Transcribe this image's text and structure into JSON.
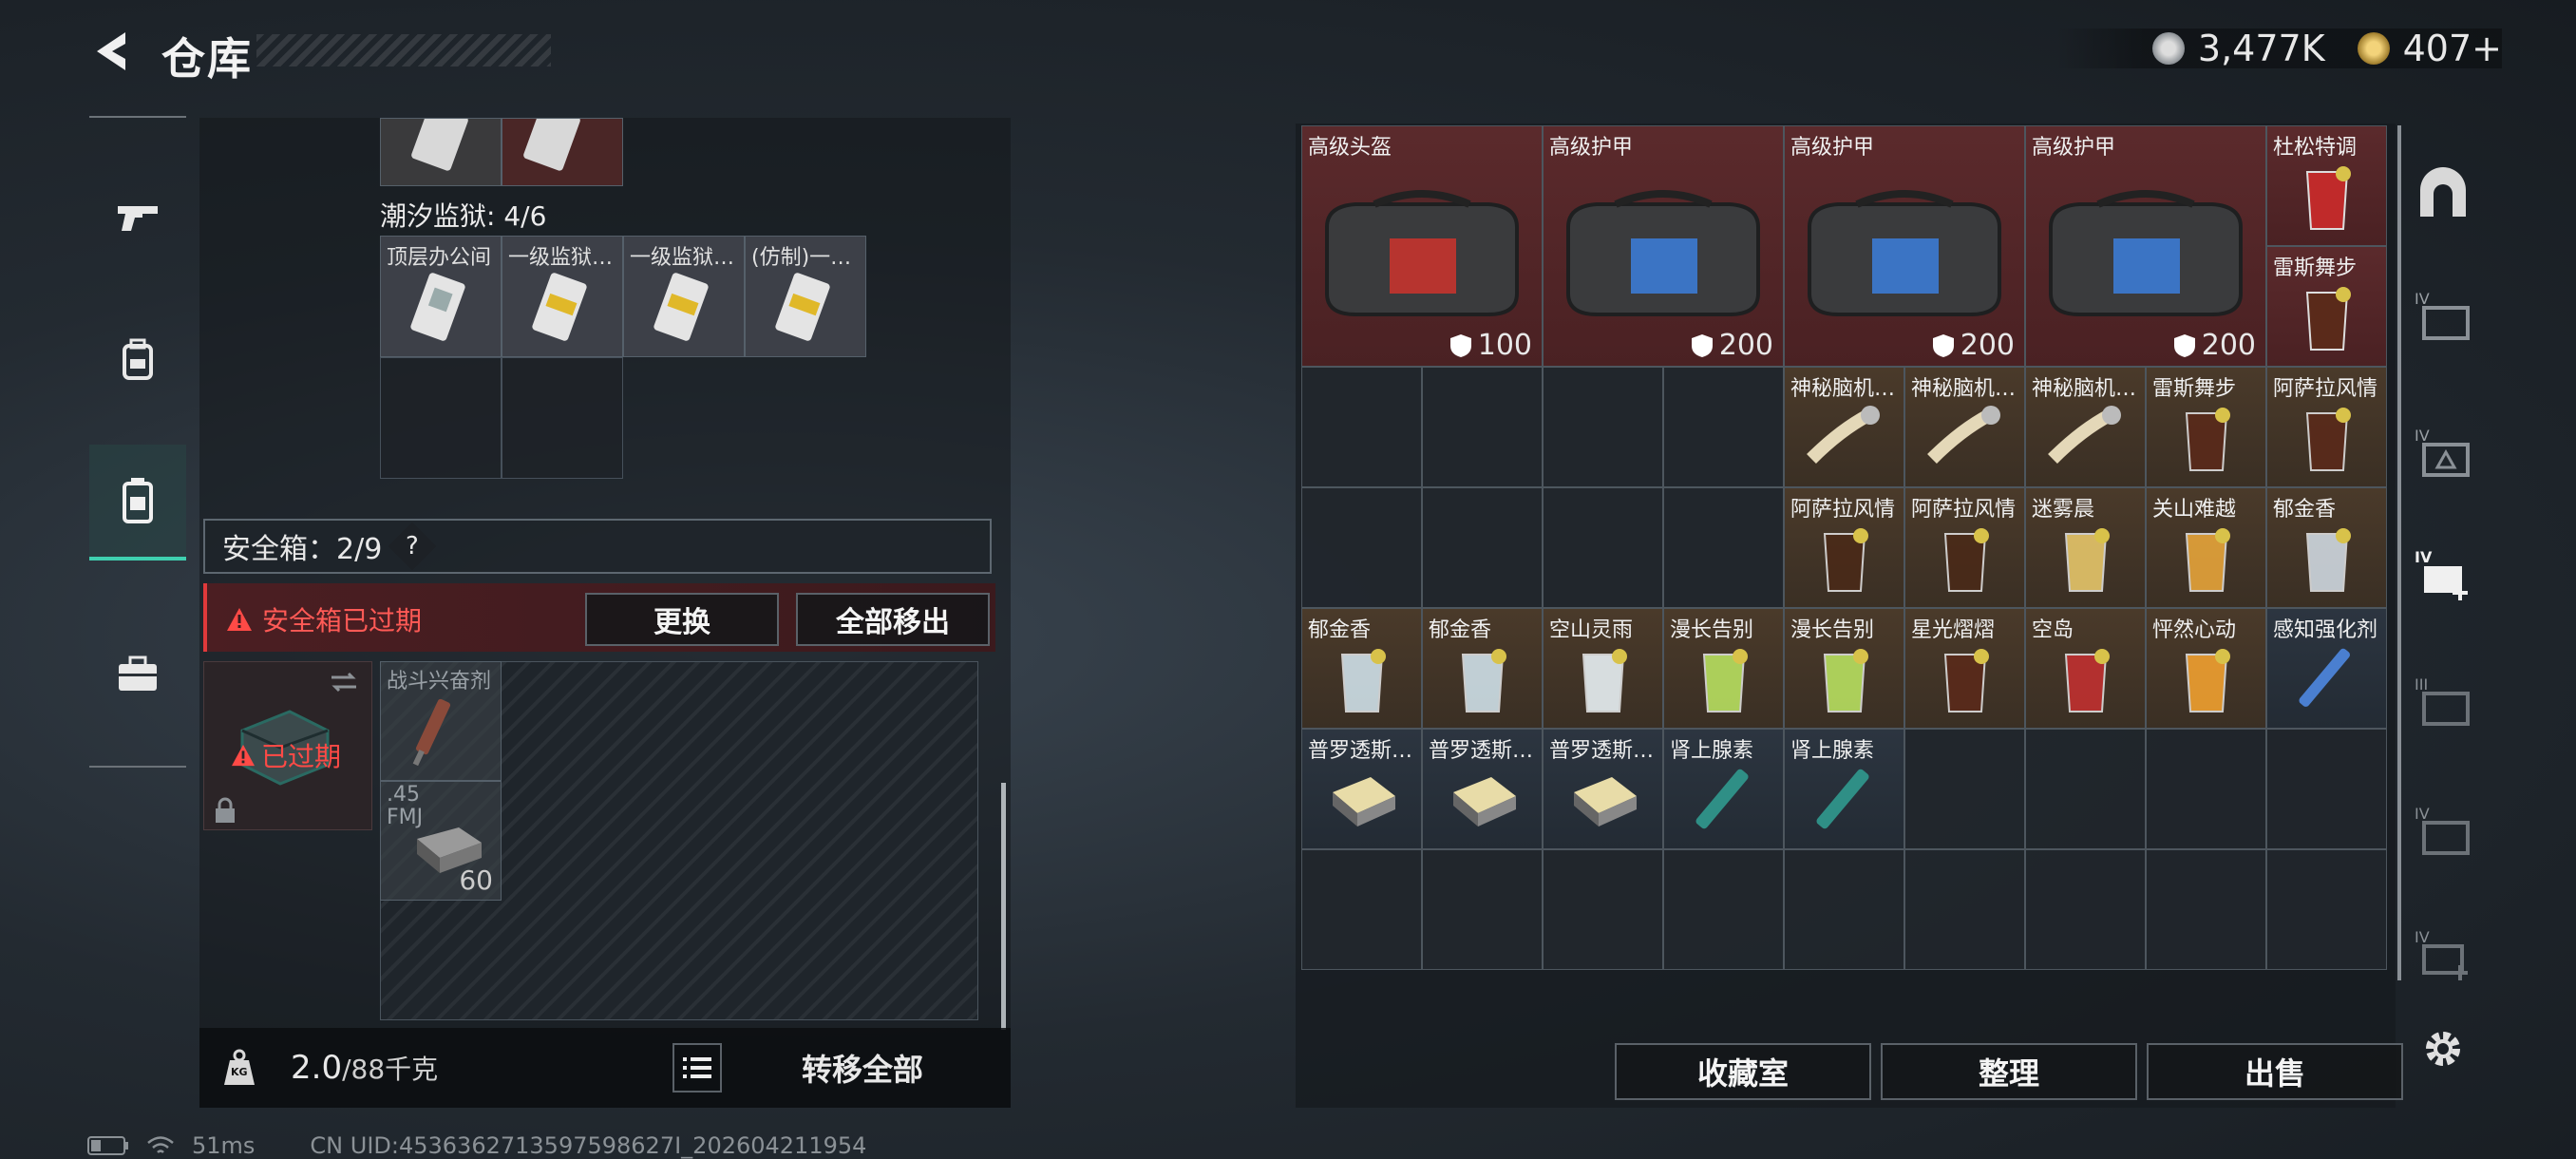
{
  "header": {
    "title": "仓库",
    "currency_1": "3,477K",
    "currency_2": "407+"
  },
  "left_panel": {
    "prison_label": "潮汐监狱: 4/6",
    "keycards": [
      "顶层办公间",
      "一级监狱…",
      "一级监狱…",
      "(仿制)一…"
    ],
    "safebox_label": "安全箱：2/9",
    "help_glyph": "?",
    "expired_warning": "安全箱已过期",
    "replace_button": "更换",
    "remove_all_button": "全部移出",
    "expired_badge": "已过期",
    "stim_label": "战斗兴奋剂",
    "ammo_label": ".45 FMJ",
    "ammo_count": "60",
    "weight_current": "2.0",
    "weight_max": "/88千克",
    "kg_glyph": "KG",
    "transfer_all_button": "转移全部"
  },
  "status_bar": {
    "ping": "51ms",
    "uid": "CN UID:4536362713597598627I_202604211954"
  },
  "right_panel": {
    "bags": [
      {
        "label": "高级头盔",
        "value": "100"
      },
      {
        "label": "高级护甲",
        "value": "200"
      },
      {
        "label": "高级护甲",
        "value": "200"
      },
      {
        "label": "高级护甲",
        "value": "200"
      }
    ],
    "drinks_top": [
      "杜松特调",
      "雷斯舞步"
    ],
    "row2": [
      "神秘脑机…",
      "神秘脑机…",
      "神秘脑机…",
      "雷斯舞步",
      "阿萨拉风情"
    ],
    "row3": [
      "阿萨拉风情",
      "阿萨拉风情",
      "迷雾晨",
      "关山难越",
      "郁金香"
    ],
    "row4": [
      "郁金香",
      "郁金香",
      "空山灵雨",
      "漫长告别",
      "漫长告别",
      "星光熠熠",
      "空岛",
      "怦然心动",
      "感知强化剂"
    ],
    "row5": [
      "普罗透斯…",
      "普罗透斯…",
      "普罗透斯…",
      "肾上腺素",
      "肾上腺素"
    ],
    "collection_button": "收藏室",
    "sort_button": "整理",
    "sell_button": "出售"
  },
  "colors": {
    "accent": "#3fd0b0",
    "warning": "#e0393b",
    "brown_cell": "#4a3a2a",
    "red_cell": "#5b2a2c"
  },
  "icons": [
    "back-arrow-icon",
    "silver-coin-icon",
    "gold-coin-icon",
    "gun-icon",
    "backpack-icon",
    "container-icon",
    "briefcase-icon",
    "warning-icon",
    "lock-icon",
    "swap-icon",
    "list-icon",
    "kg-weight-icon",
    "helmet-icon",
    "vest-icon",
    "settings-icon",
    "battery-icon",
    "wifi-icon"
  ]
}
